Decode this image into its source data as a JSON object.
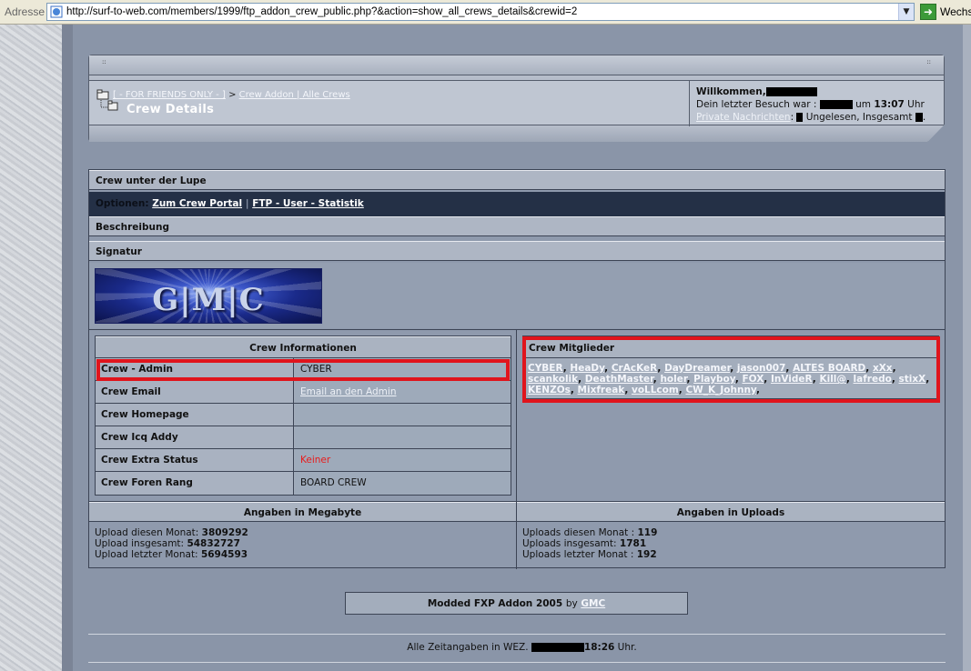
{
  "browser": {
    "address_label": "Adresse",
    "url": "http://surf-to-web.com/members/1999/ftp_addon_crew_public.php?&action=show_all_crews_details&crewid=2",
    "go_label": "Wechs"
  },
  "header": {
    "breadcrumb_root": "[ - FOR FRIENDS ONLY - ]",
    "breadcrumb_sep": ">",
    "breadcrumb_crew": "Crew Addon | Alle Crews",
    "page_title": "Crew Details",
    "welcome": "Willkommen,",
    "last_visit": "Dein letzter Besuch war :",
    "last_visit_at": "um",
    "last_visit_time": "13:07",
    "last_visit_unit": "Uhr",
    "pm_link": "Private Nachrichten",
    "pm_unread": ": ",
    "pm_unread_label": " Ungelesen, Insgesamt"
  },
  "crew_section": {
    "title": "Crew unter der Lupe",
    "options_label": "Optionen:",
    "option_portal": "Zum Crew Portal",
    "option_sep": "|",
    "option_ftp": "FTP - User - Statistik",
    "description": "Beschreibung",
    "signature": "Signatur",
    "banner_text": "G|M|C"
  },
  "crew_info": {
    "caption": "Crew Informationen",
    "rows": [
      {
        "label": "Crew - Admin",
        "value": "CYBER"
      },
      {
        "label": "Crew Email",
        "value": "Email an den Admin"
      },
      {
        "label": "Crew Homepage",
        "value": ""
      },
      {
        "label": "Crew Icq Addy",
        "value": ""
      },
      {
        "label": "Crew Extra Status",
        "value": "Keiner"
      },
      {
        "label": "Crew Foren Rang",
        "value": "BOARD CREW"
      }
    ]
  },
  "members": {
    "title": "Crew Mitglieder",
    "names": [
      "CYBER",
      "HeaDy",
      "CrAcKeR",
      "DayDreamer",
      "jason007",
      "ALTES BOARD",
      "xXx",
      "scankolik",
      "DeathMaster",
      "holer",
      "Playboy",
      "FOX",
      "InVideR",
      "Kill@",
      "lafredo",
      "stixX",
      "KENZOs",
      "Mixfreak",
      "voLLcom",
      "CW_K_Johnny"
    ]
  },
  "stats": {
    "mb_title": "Angaben in Megabyte",
    "mb_month_label": "Upload diesen Monat:",
    "mb_month": "3809292",
    "mb_total_label": "Upload insgesamt:",
    "mb_total": "54832727",
    "mb_last_label": "Upload letzter Monat:",
    "mb_last": "5694593",
    "up_title": "Angaben in Uploads",
    "up_month_label": "Uploads diesen Monat :",
    "up_month": "119",
    "up_total_label": "Uploads insgesamt:",
    "up_total": "1781",
    "up_last_label": "Uploads letzter Monat :",
    "up_last": "192"
  },
  "footer": {
    "credit": "Modded FXP Addon 2005",
    "by": "by",
    "author": "GMC",
    "tz_label": "Alle Zeitangaben in WEZ.",
    "tz_time": "18:26",
    "tz_unit": "Uhr."
  }
}
